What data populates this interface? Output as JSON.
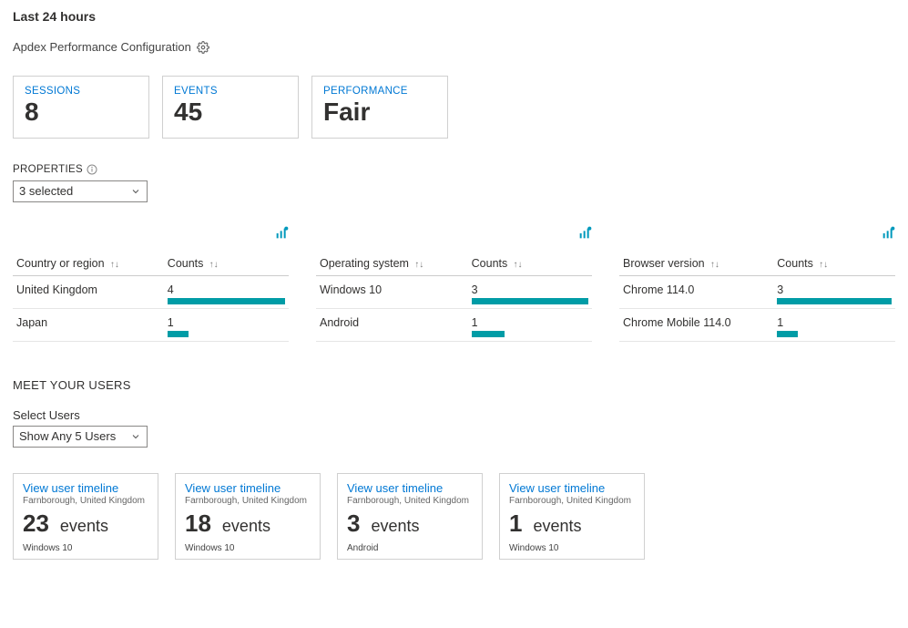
{
  "header": {
    "time_range": "Last 24 hours",
    "config_label": "Apdex Performance Configuration"
  },
  "metrics": {
    "sessions": {
      "label": "SESSIONS",
      "value": "8"
    },
    "events": {
      "label": "EVENTS",
      "value": "45"
    },
    "performance": {
      "label": "PERFORMANCE",
      "value": "Fair"
    }
  },
  "properties": {
    "section_label": "PROPERTIES",
    "selected_text": "3 selected"
  },
  "tables": {
    "country": {
      "name_header": "Country or region",
      "count_header": "Counts",
      "rows": [
        {
          "name": "United Kingdom",
          "count": "4",
          "bar_pct": 100
        },
        {
          "name": "Japan",
          "count": "1",
          "bar_pct": 18
        }
      ]
    },
    "os": {
      "name_header": "Operating system",
      "count_header": "Counts",
      "rows": [
        {
          "name": "Windows 10",
          "count": "3",
          "bar_pct": 100
        },
        {
          "name": "Android",
          "count": "1",
          "bar_pct": 28
        }
      ]
    },
    "browser": {
      "name_header": "Browser version",
      "count_header": "Counts",
      "rows": [
        {
          "name": "Chrome 114.0",
          "count": "3",
          "bar_pct": 100
        },
        {
          "name": "Chrome Mobile 114.0",
          "count": "1",
          "bar_pct": 18
        }
      ]
    }
  },
  "users_section": {
    "heading": "MEET YOUR USERS",
    "select_label": "Select Users",
    "dropdown_text": "Show Any 5 Users",
    "link_text": "View user timeline",
    "events_unit": "events",
    "cards": [
      {
        "location": "Farnborough, United Kingdom",
        "count": "23",
        "os": "Windows 10"
      },
      {
        "location": "Farnborough, United Kingdom",
        "count": "18",
        "os": "Windows 10"
      },
      {
        "location": "Farnborough, United Kingdom",
        "count": "3",
        "os": "Android"
      },
      {
        "location": "Farnborough, United Kingdom",
        "count": "1",
        "os": "Windows 10"
      }
    ]
  },
  "chart_data": [
    {
      "type": "bar",
      "title": "Country or region — Counts",
      "categories": [
        "United Kingdom",
        "Japan"
      ],
      "values": [
        4,
        1
      ]
    },
    {
      "type": "bar",
      "title": "Operating system — Counts",
      "categories": [
        "Windows 10",
        "Android"
      ],
      "values": [
        3,
        1
      ]
    },
    {
      "type": "bar",
      "title": "Browser version — Counts",
      "categories": [
        "Chrome 114.0",
        "Chrome Mobile 114.0"
      ],
      "values": [
        3,
        1
      ]
    }
  ]
}
